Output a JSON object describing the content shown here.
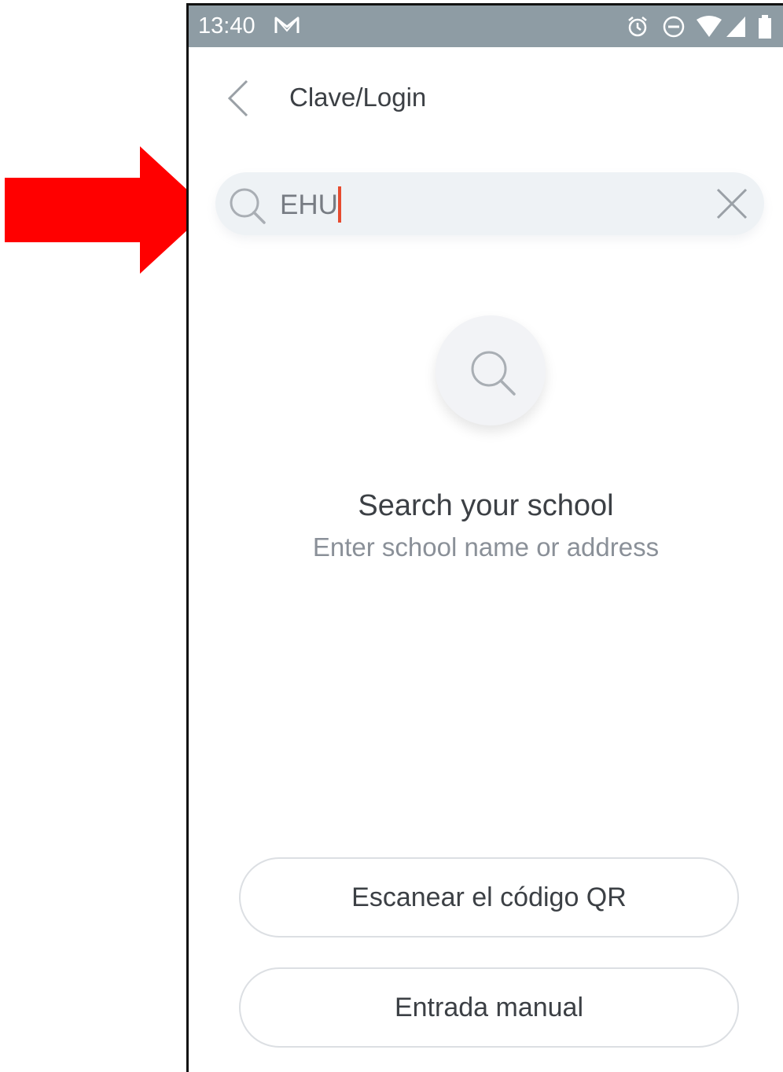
{
  "status_bar": {
    "time": "13:40",
    "icons": [
      "gmail-icon",
      "alarm-icon",
      "do-not-disturb-icon",
      "wifi-icon",
      "signal-icon",
      "battery-icon"
    ]
  },
  "header": {
    "title": "Clave/Login",
    "back_icon": "chevron-left-icon"
  },
  "search": {
    "value": "EHU",
    "icon": "search-icon",
    "clear_icon": "close-icon"
  },
  "empty_state": {
    "icon": "search-icon",
    "title": "Search your school",
    "subtitle": "Enter school name or address"
  },
  "actions": {
    "scan_qr_label": "Escanear el código QR",
    "manual_entry_label": "Entrada manual"
  },
  "colors": {
    "status_bar": "#8e9ca4",
    "annotation_arrow": "#ff0000",
    "caret": "#e64b2f",
    "search_bg": "#eef2f5"
  }
}
